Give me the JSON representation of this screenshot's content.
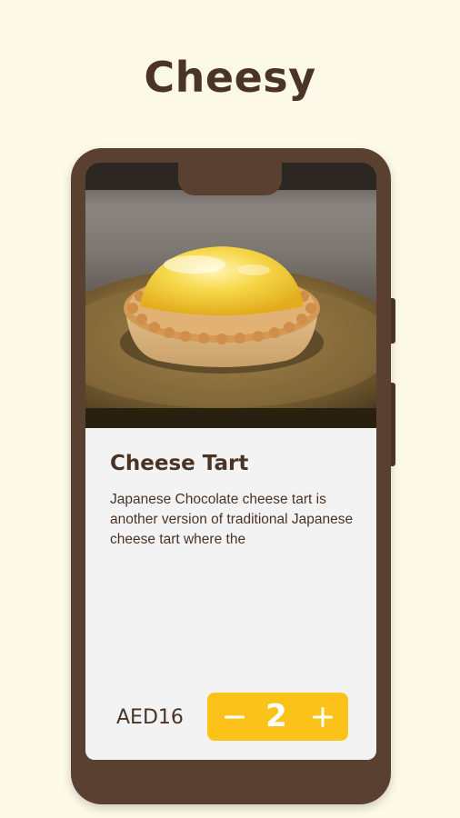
{
  "header": {
    "title": "Cheesy"
  },
  "product": {
    "name": "Cheese Tart",
    "description": "Japanese Chocolate cheese tart is another version of traditional Japanese cheese tart where the",
    "price": "AED16",
    "image_icon": "cheese-tart-photo"
  },
  "quantity": {
    "value": "2",
    "decrement_icon": "minus-icon",
    "increment_icon": "plus-icon"
  },
  "colors": {
    "background": "#fdf9e8",
    "phone_frame": "#5a4030",
    "text": "#4a3426",
    "accent": "#fbc31a",
    "card": "#f3f3f3"
  }
}
